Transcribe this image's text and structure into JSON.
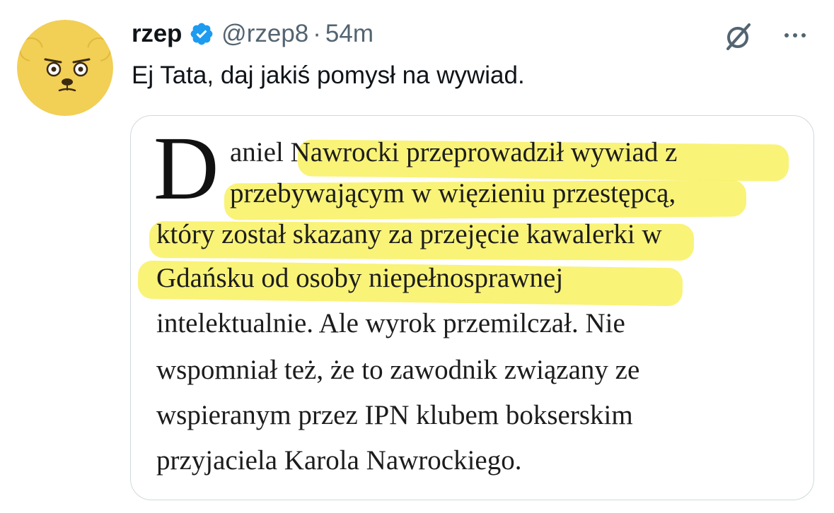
{
  "tweet": {
    "display_name": "rzep",
    "handle": "@rzep8",
    "separator": "·",
    "time": "54m",
    "text": "Ej Tata, daj jakiś pomysł na wywiad."
  },
  "icons": {
    "avatar": "yellow-bear-avatar",
    "verified": "verified-badge-icon",
    "grok": "grok-icon",
    "more": "more-icon"
  },
  "colors": {
    "verified": "#1d9bf0",
    "highlight": "#f8f26c",
    "avatar_bg": "#f2cf55",
    "secondary_text": "#536471"
  },
  "article": {
    "drop_cap": "D",
    "lines": [
      "aniel Nawrocki przeprowadził wywiad z",
      "przebywającym w więzieniu przestępcą,",
      "który został skazany za przejęcie kawalerki w",
      "Gdańsku od osoby niepełnosprawnej",
      "intelektualnie. Ale wyrok przemilczał. Nie",
      "wspomniał też, że to zawodnik związany ze",
      "wspieranym przez IPN klubem bokserskim",
      "przyjaciela Karola Nawrockiego."
    ]
  }
}
